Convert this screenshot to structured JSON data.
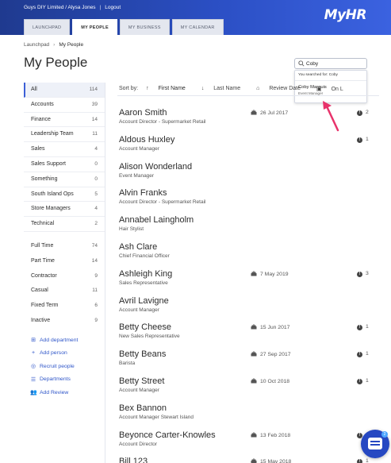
{
  "header": {
    "org": "Guys DIY Limited / Alysa Jones",
    "separator": "|",
    "logout": "Logout",
    "logo": "MyHR",
    "tabs": [
      {
        "label": "LAUNCHPAD",
        "active": false
      },
      {
        "label": "MY PEOPLE",
        "active": true
      },
      {
        "label": "MY BUSINESS",
        "active": false
      },
      {
        "label": "MY CALENDAR",
        "active": false
      }
    ]
  },
  "breadcrumb": {
    "root": "Launchpad",
    "current": "My People"
  },
  "page_title": "My People",
  "search": {
    "value": "Coby",
    "hint": "You searched for: Coby",
    "result_name": "Coby Marquis",
    "result_title": "Event Manager"
  },
  "sidebar": {
    "departments": [
      {
        "label": "All",
        "count": "114",
        "active": true
      },
      {
        "label": "Accounts",
        "count": "39"
      },
      {
        "label": "Finance",
        "count": "14"
      },
      {
        "label": "Leadership Team",
        "count": "11"
      },
      {
        "label": "Sales",
        "count": "4"
      },
      {
        "label": "Sales Support",
        "count": "0"
      },
      {
        "label": "Something",
        "count": "0"
      },
      {
        "label": "South Island Ops",
        "count": "5"
      },
      {
        "label": "Store Managers",
        "count": "4"
      },
      {
        "label": "Technical",
        "count": "2"
      }
    ],
    "types": [
      {
        "label": "Full Time",
        "count": "74"
      },
      {
        "label": "Part Time",
        "count": "14"
      },
      {
        "label": "Contractor",
        "count": "9"
      },
      {
        "label": "Casual",
        "count": "11"
      },
      {
        "label": "Fixed Term",
        "count": "6"
      },
      {
        "label": "Inactive",
        "count": "9"
      }
    ],
    "actions": [
      {
        "label": "Add department",
        "icon": "plus-square-icon"
      },
      {
        "label": "Add person",
        "icon": "plus-icon"
      },
      {
        "label": "Recruit people",
        "icon": "target-icon"
      },
      {
        "label": "Departments",
        "icon": "list-icon"
      },
      {
        "label": "Add Review",
        "icon": "people-icon"
      }
    ]
  },
  "sort": {
    "label": "Sort by:",
    "options": [
      "First Name",
      "Last Name",
      "Review Date",
      "On L"
    ]
  },
  "people": [
    {
      "name": "Aaron Smith",
      "role": "Account Director - Supermarket Retail",
      "date": "26 Jul 2017",
      "count": "2"
    },
    {
      "name": "Aldous Huxley",
      "role": "Account Manager",
      "date": "",
      "count": "1"
    },
    {
      "name": "Alison Wonderland",
      "role": "Event Manager",
      "date": "",
      "count": ""
    },
    {
      "name": "Alvin Franks",
      "role": "Account Director - Supermarket Retail",
      "date": "",
      "count": ""
    },
    {
      "name": "Annabel Laingholm",
      "role": "Hair Stylist",
      "date": "",
      "count": ""
    },
    {
      "name": "Ash Clare",
      "role": "Chief Financial Officer",
      "date": "",
      "count": ""
    },
    {
      "name": "Ashleigh King",
      "role": "Sales Representative",
      "date": "7 May 2019",
      "count": "3"
    },
    {
      "name": "Avril Lavigne",
      "role": "Account Manager",
      "date": "",
      "count": ""
    },
    {
      "name": "Betty Cheese",
      "role": "New Sales Representative",
      "date": "15 Jun 2017",
      "count": "1"
    },
    {
      "name": "Betty Beans",
      "role": "Barista",
      "date": "27 Sep 2017",
      "count": "1"
    },
    {
      "name": "Betty Street",
      "role": "Account Manager",
      "date": "10 Oct 2018",
      "count": "1"
    },
    {
      "name": "Bex Bannon",
      "role": "Account Manager Stewart Island",
      "date": "",
      "count": ""
    },
    {
      "name": "Beyonce Carter-Knowles",
      "role": "Account Director",
      "date": "13 Feb 2018",
      "count": "1"
    },
    {
      "name": "Bill 123",
      "role": "",
      "date": "15 May 2018",
      "count": "1"
    }
  ],
  "chat": {
    "badge": "2"
  },
  "colors": {
    "accent": "#2f56c9",
    "header": "#2b4fc4",
    "annotation_arrow": "#e8336b"
  }
}
